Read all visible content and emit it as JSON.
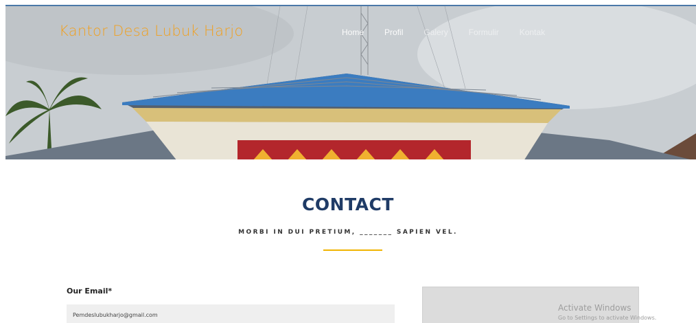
{
  "header": {
    "brand": "Kantor Desa Lubuk Harjo",
    "nav": [
      {
        "label": "Home"
      },
      {
        "label": "Profil"
      },
      {
        "label": "Galery"
      },
      {
        "label": "Formulir"
      },
      {
        "label": "Kontak"
      }
    ]
  },
  "contact": {
    "title": "CONTACT",
    "subtitle": "MORBI IN DUI PRETIUM, _______ SAPIEN VEL."
  },
  "form": {
    "email_label": "Our Email*",
    "email_value": "Pemdeslubukharjo@gmail.com"
  },
  "watermark": {
    "line1": "Activate Windows",
    "line2": "Go to Settings to activate Windows."
  },
  "colors": {
    "brand": "#f0a020",
    "title": "#1f3b66",
    "accent_underline": "#f0b400",
    "field_bg": "#efefef"
  }
}
